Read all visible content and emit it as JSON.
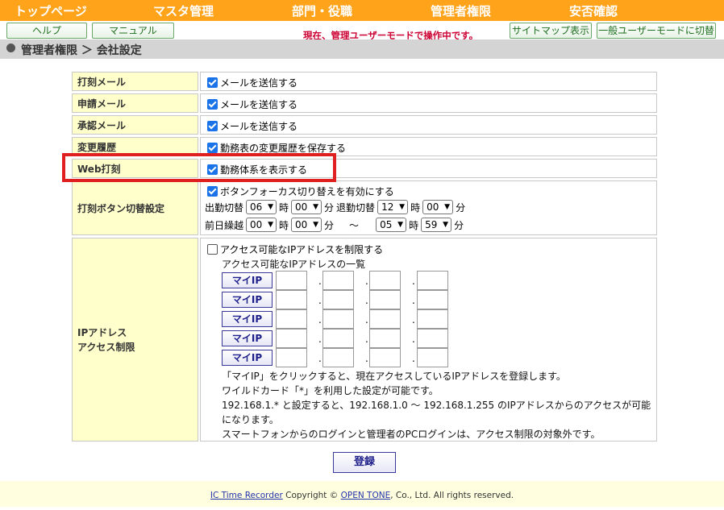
{
  "topnav": {
    "items": [
      "トップページ",
      "マスタ管理",
      "部門・役職",
      "管理者権限",
      "安否確認"
    ]
  },
  "toolbar": {
    "help": "ヘルプ",
    "manual": "マニュアル",
    "mode_notice": "現在、管理ユーザーモードで操作中です。",
    "sitemap": "サイトマップ表示",
    "switch_mode": "一般ユーザーモードに切替"
  },
  "breadcrumb": "管理者権限 ＞ 会社設定",
  "rows": {
    "punch_mail": {
      "label": "打刻メール",
      "checkbox": "メールを送信する",
      "checked": true
    },
    "request_mail": {
      "label": "申請メール",
      "checkbox": "メールを送信する",
      "checked": true
    },
    "approve_mail": {
      "label": "承認メール",
      "checkbox": "メールを送信する",
      "checked": true
    },
    "history": {
      "label": "変更履歴",
      "checkbox": "勤務表の変更履歴を保存する",
      "checked": true
    },
    "web_punch": {
      "label": "Web打刻",
      "checkbox": "勤務体系を表示する",
      "checked": true
    },
    "punch_switch": {
      "label": "打刻ボタン切替設定",
      "checkbox": "ボタンフォーカス切り替えを有効にする",
      "checked": true,
      "line1": {
        "in_label": "出勤切替",
        "in_hour": "06",
        "hour_unit": "時",
        "in_min": "00",
        "min_unit": "分",
        "out_label": "退勤切替",
        "out_hour": "12",
        "out_min": "00"
      },
      "line2": {
        "label": "前日繰越",
        "from_hour": "00",
        "hour_unit": "時",
        "from_min": "00",
        "min_unit": "分",
        "tilde": "〜",
        "to_hour": "05",
        "to_min": "59"
      }
    },
    "ip": {
      "label_line1": "IPアドレス",
      "label_line2": "アクセス制限",
      "checkbox": "アクセス可能なIPアドレスを制限する",
      "checked": false,
      "list_title": "アクセス可能なIPアドレスの一覧",
      "my_ip_button": "マイIP",
      "dot": ".",
      "notes": [
        "「マイIP」をクリックすると、現在アクセスしているIPアドレスを登録します。",
        "ワイルドカード「*」を利用した設定が可能です。",
        "192.168.1.* と設定すると、192.168.1.0 〜 192.168.1.255 のIPアドレスからのアクセスが可能",
        "になります。",
        "スマートフォンからのログインと管理者のPCログインは、アクセス制限の対象外です。"
      ]
    }
  },
  "submit": "登録",
  "footer": {
    "product": "IC Time Recorder",
    "copyright": "Copyright ©",
    "company": "OPEN TONE",
    "rights": ", Co., Ltd. All rights reserved."
  },
  "colors": {
    "nav": "#ffa31a",
    "label_bg": "#ffffcc",
    "highlight": "#e02020",
    "notice": "#cc0033"
  }
}
